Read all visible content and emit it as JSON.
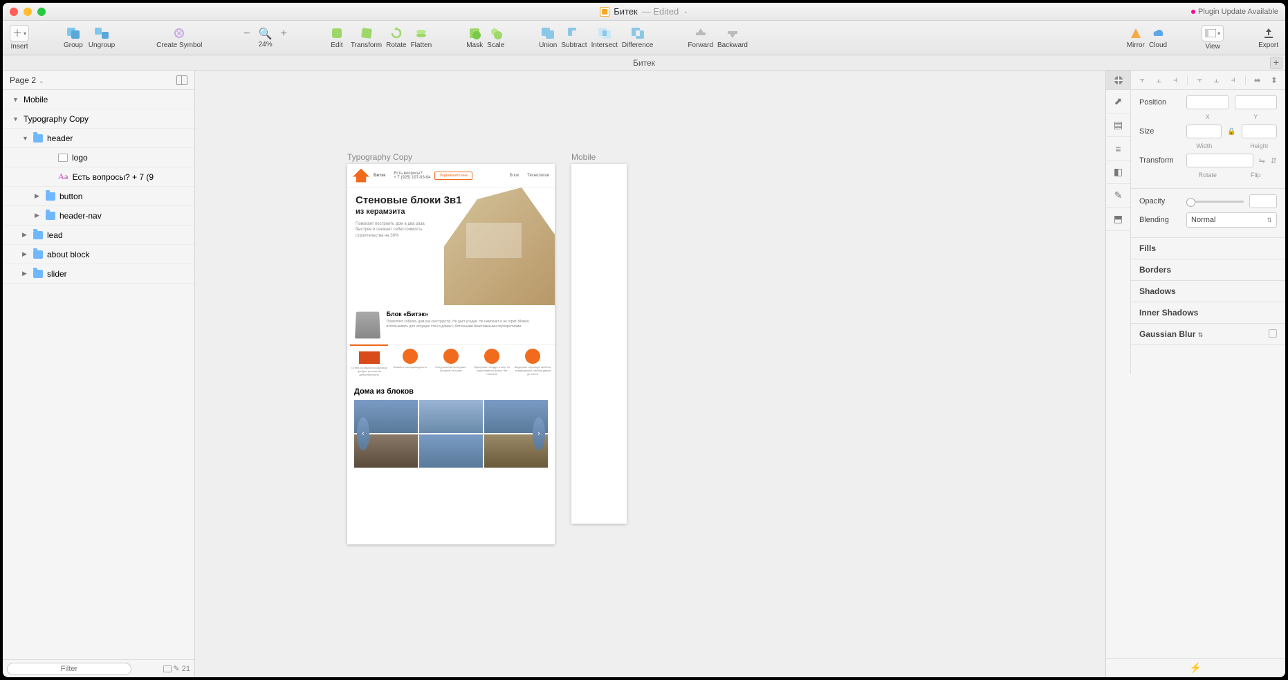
{
  "titlebar": {
    "doc_name": "Битек",
    "edited": "— Edited",
    "plugin": "Plugin Update Available"
  },
  "toolbar": {
    "insert": "Insert",
    "group": "Group",
    "ungroup": "Ungroup",
    "create_symbol": "Create Symbol",
    "zoom": "24%",
    "edit": "Edit",
    "transform": "Transform",
    "rotate": "Rotate",
    "flatten": "Flatten",
    "mask": "Mask",
    "scale": "Scale",
    "union": "Union",
    "subtract": "Subtract",
    "intersect": "Intersect",
    "difference": "Difference",
    "forward": "Forward",
    "backward": "Backward",
    "mirror": "Mirror",
    "cloud": "Cloud",
    "view": "View",
    "export": "Export"
  },
  "docstrip": {
    "name": "Битек"
  },
  "pages": {
    "current": "Page 2"
  },
  "layers": [
    {
      "name": "Mobile",
      "type": "artboard",
      "indent": 0,
      "open": true,
      "tri": "▼"
    },
    {
      "name": "Typography Copy",
      "type": "artboard",
      "indent": 0,
      "open": true,
      "tri": "▼"
    },
    {
      "name": "header",
      "type": "folder",
      "indent": 1,
      "open": true,
      "tri": "▼"
    },
    {
      "name": "logo",
      "type": "layer",
      "indent": 2,
      "open": false,
      "tri": ""
    },
    {
      "name": "Есть вопросы? + 7 (9",
      "type": "text",
      "indent": 2,
      "open": false,
      "tri": ""
    },
    {
      "name": "button",
      "type": "folder",
      "indent": 2,
      "open": false,
      "tri": "▶"
    },
    {
      "name": "header-nav",
      "type": "folder",
      "indent": 2,
      "open": false,
      "tri": "▶"
    },
    {
      "name": "lead",
      "type": "folder",
      "indent": 1,
      "open": false,
      "tri": "▶"
    },
    {
      "name": "about block",
      "type": "folder",
      "indent": 1,
      "open": false,
      "tri": "▶"
    },
    {
      "name": "slider",
      "type": "folder",
      "indent": 1,
      "open": false,
      "tri": "▶"
    }
  ],
  "filter": {
    "placeholder": "Filter",
    "count": "21"
  },
  "canvas": {
    "artboard1_label": "Typography Copy",
    "artboard2_label": "Mobile",
    "mock": {
      "logo_text": "Битэк",
      "question": "Есть вопросы?",
      "phone": "+ 7 (925) 197-93-94",
      "cta": "Перезвоните мне",
      "nav1": "Блок",
      "nav2": "Технологии",
      "h1": "Стеновые блоки 3в1",
      "h2": "из керамзита",
      "hero_p": "Помогает построить дом в два раза быстрее и снижает себестоимость строительства на 30%",
      "block_title": "Блок «Битэк»",
      "block_p": "Позволяет собрать дом как конструктор. Не дает усадки. Не намокает и не горит. Можно использовать для несущих стен в домах с бетонными межэтажными перекрытиями",
      "feat1": "Стена из обычного кирпича требует утепления дополнительно",
      "feat2": "Низкая теплопроводность",
      "feat3": "Натуральный материал, который не горит",
      "feat4": "Пропускает воздух и пар, не скапливается влага, нет плесени",
      "feat5": "Выдержит кухонную мебель, кондиционер, любые двери до 100 кг",
      "houses_title": "Дома из блоков"
    }
  },
  "inspector": {
    "position": "Position",
    "x": "X",
    "y": "Y",
    "size": "Size",
    "width": "Width",
    "height": "Height",
    "transform": "Transform",
    "rotate": "Rotate",
    "flip": "Flip",
    "opacity": "Opacity",
    "blending": "Blending",
    "blend_value": "Normal",
    "fills": "Fills",
    "borders": "Borders",
    "shadows": "Shadows",
    "inner_shadows": "Inner Shadows",
    "gaussian_blur": "Gaussian Blur"
  }
}
